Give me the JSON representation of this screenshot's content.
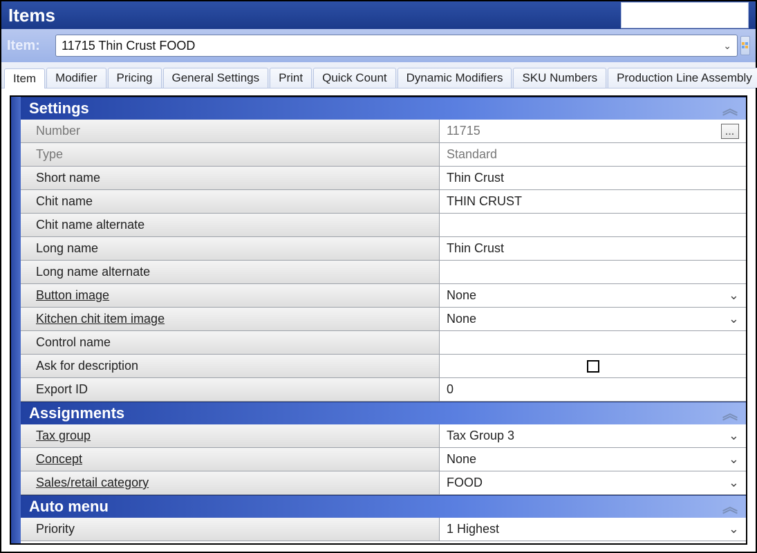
{
  "window": {
    "title": "Items"
  },
  "item_selector": {
    "label": "Item:",
    "value": "11715 Thin Crust FOOD"
  },
  "tabs": [
    {
      "label": "Item",
      "active": true
    },
    {
      "label": "Modifier",
      "active": false
    },
    {
      "label": "Pricing",
      "active": false
    },
    {
      "label": "General Settings",
      "active": false
    },
    {
      "label": "Print",
      "active": false
    },
    {
      "label": "Quick Count",
      "active": false
    },
    {
      "label": "Dynamic Modifiers",
      "active": false
    },
    {
      "label": "SKU Numbers",
      "active": false
    },
    {
      "label": "Production Line Assembly",
      "active": false
    }
  ],
  "sections": {
    "settings": {
      "title": "Settings",
      "rows": {
        "number": {
          "label": "Number",
          "value": "11715",
          "hasEllipsis": true,
          "dim": true
        },
        "type": {
          "label": "Type",
          "value": "Standard",
          "dim": true
        },
        "short_name": {
          "label": "Short name",
          "value": "Thin Crust"
        },
        "chit_name": {
          "label": "Chit name",
          "value": "THIN CRUST"
        },
        "chit_alt": {
          "label": "Chit name alternate",
          "value": ""
        },
        "long_name": {
          "label": "Long name",
          "value": "Thin Crust"
        },
        "long_alt": {
          "label": "Long name alternate",
          "value": ""
        },
        "button_img": {
          "label": "Button image",
          "value": "None",
          "underlined": true,
          "dropdown": true
        },
        "kitchen_img": {
          "label": "Kitchen chit item image",
          "value": "None",
          "underlined": true,
          "dropdown": true
        },
        "control_name": {
          "label": "Control name",
          "value": ""
        },
        "ask_desc": {
          "label": "Ask for description",
          "checkbox": true,
          "checked": false
        },
        "export_id": {
          "label": "Export ID",
          "value": "0"
        }
      }
    },
    "assignments": {
      "title": "Assignments",
      "rows": {
        "tax_group": {
          "label": "Tax group",
          "value": "Tax Group 3",
          "underlined": true,
          "dropdown": true
        },
        "concept": {
          "label": "Concept",
          "value": "None",
          "underlined": true,
          "dropdown": true
        },
        "sales_cat": {
          "label": "Sales/retail category",
          "value": "FOOD",
          "underlined": true,
          "dropdown": true
        }
      }
    },
    "auto_menu": {
      "title": "Auto menu",
      "rows": {
        "priority": {
          "label": "Priority",
          "value": "1 Highest",
          "dropdown": true
        }
      }
    }
  }
}
